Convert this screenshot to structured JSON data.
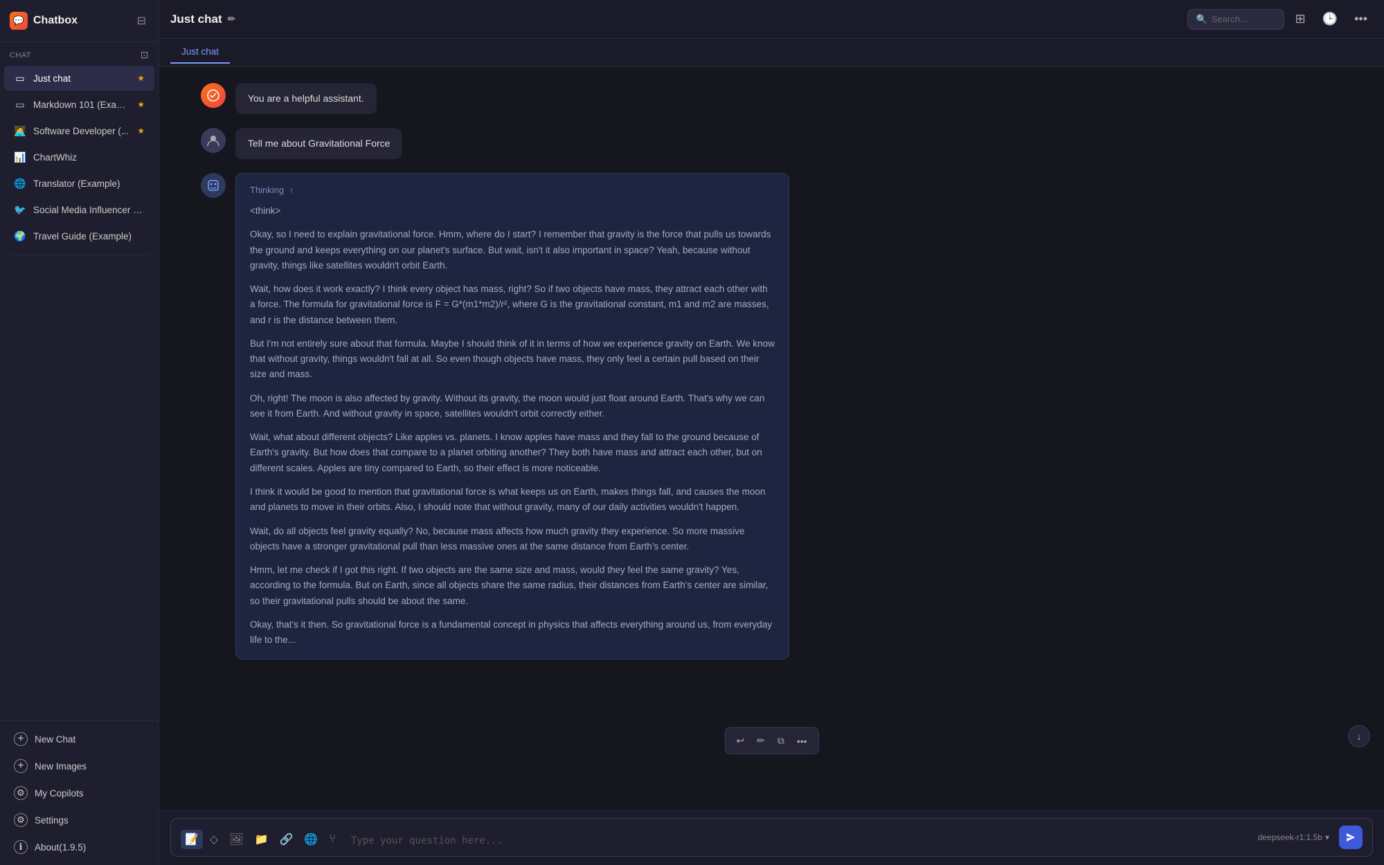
{
  "app": {
    "title": "Chatbox",
    "icon": "💬",
    "version": "About(1.9.5)"
  },
  "sidebar": {
    "section_label": "Chat",
    "items": [
      {
        "id": "just-chat",
        "label": "Just chat",
        "icon": "▭",
        "starred": true,
        "active": true
      },
      {
        "id": "markdown",
        "label": "Markdown 101 (Exam...",
        "icon": "▭",
        "starred": true,
        "active": false
      },
      {
        "id": "software-dev",
        "label": "Software Developer (...",
        "icon": "🧑‍💻",
        "starred": true,
        "active": false
      },
      {
        "id": "chartwhiz",
        "label": "ChartWhiz",
        "icon": "📊",
        "starred": false,
        "active": false
      },
      {
        "id": "translator",
        "label": "Translator (Example)",
        "icon": "🌐",
        "starred": false,
        "active": false
      },
      {
        "id": "social-media",
        "label": "Social Media Influencer (E...",
        "icon": "🐦",
        "starred": false,
        "active": false
      },
      {
        "id": "travel-guide",
        "label": "Travel Guide (Example)",
        "icon": "🌍",
        "starred": false,
        "active": false
      }
    ],
    "bottom_items": [
      {
        "id": "new-chat",
        "label": "New Chat",
        "icon": "+"
      },
      {
        "id": "new-images",
        "label": "New Images",
        "icon": "+"
      },
      {
        "id": "my-copilots",
        "label": "My Copilots",
        "icon": "⚙"
      },
      {
        "id": "settings",
        "label": "Settings",
        "icon": "⚙"
      },
      {
        "id": "about",
        "label": "About(1.9.5)",
        "icon": "ℹ"
      }
    ]
  },
  "topbar": {
    "title": "Just chat",
    "search_placeholder": "Search...",
    "buttons": [
      "layout",
      "history",
      "more"
    ]
  },
  "tabs": [
    {
      "id": "just-chat",
      "label": "Just chat",
      "active": true
    }
  ],
  "messages": [
    {
      "id": "system-msg",
      "role": "system",
      "avatar_type": "system",
      "content": "You are a helpful assistant."
    },
    {
      "id": "user-msg",
      "role": "user",
      "avatar_type": "user",
      "content": "Tell me about Gravitational Force"
    },
    {
      "id": "ai-thinking",
      "role": "assistant",
      "avatar_type": "ai",
      "thinking_label": "Thinking",
      "thinking_content": [
        "<think>",
        "Okay, so I need to explain gravitational force. Hmm, where do I start? I remember that gravity is the force that pulls us towards the ground and keeps everything on our planet's surface. But wait, isn't it also important in space? Yeah, because without gravity, things like satellites wouldn't orbit Earth.",
        "Wait, how does it work exactly? I think every object has mass, right? So if two objects have mass, they attract each other with a force. The formula for gravitational force is F = G*(m1*m2)/r², where G is the gravitational constant, m1 and m2 are masses, and r is the distance between them.",
        "But I'm not entirely sure about that formula. Maybe I should think of it in terms of how we experience gravity on Earth. We know that without gravity, things wouldn't fall at all. So even though objects have mass, they only feel a certain pull based on their size and mass.",
        "Oh, right! The moon is also affected by gravity. Without its gravity, the moon would just float around Earth. That's why we can see it from Earth. And without gravity in space, satellites wouldn't orbit correctly either.",
        "Wait, what about different objects? Like apples vs. planets. I know apples have mass and they fall to the ground because of Earth's gravity. But how does that compare to a planet orbiting another? They both have mass and attract each other, but on different scales. Apples are tiny compared to Earth, so their effect is more noticeable.",
        "I think it would be good to mention that gravitational force is what keeps us on Earth, makes things fall, and causes the moon and planets to move in their orbits. Also, I should note that without gravity, many of our daily activities wouldn't happen.",
        "Wait, do all objects feel gravity equally? No, because mass affects how much gravity they experience. So more massive objects have a stronger gravitational pull than less massive ones at the same distance from Earth's center.",
        "Hmm, let me check if I got this right. If two objects are the same size and mass, would they feel the same gravity? Yes, according to the formula. But on Earth, since all objects share the same radius, their distances from Earth's center are similar, so their gravitational pulls should be about the same.",
        "Okay, that's it then. So gravitational force is a fundamental concept in physics that affects everything around us, from everyday life to the..."
      ]
    }
  ],
  "floating_toolbar": {
    "buttons": [
      "undo",
      "edit",
      "copy",
      "more"
    ]
  },
  "input": {
    "placeholder": "Type your question here...",
    "model_label": "deepseek-r1:1.5b",
    "tools": [
      "text",
      "eraser",
      "image",
      "folder",
      "link",
      "globe",
      "branch"
    ]
  },
  "colors": {
    "accent": "#3d5adb",
    "star": "#f59e0b",
    "thinking_bg": "#1e2540",
    "sidebar_bg": "#1e1e2e",
    "main_bg": "#16161f",
    "topbar_bg": "#1a1a28"
  }
}
